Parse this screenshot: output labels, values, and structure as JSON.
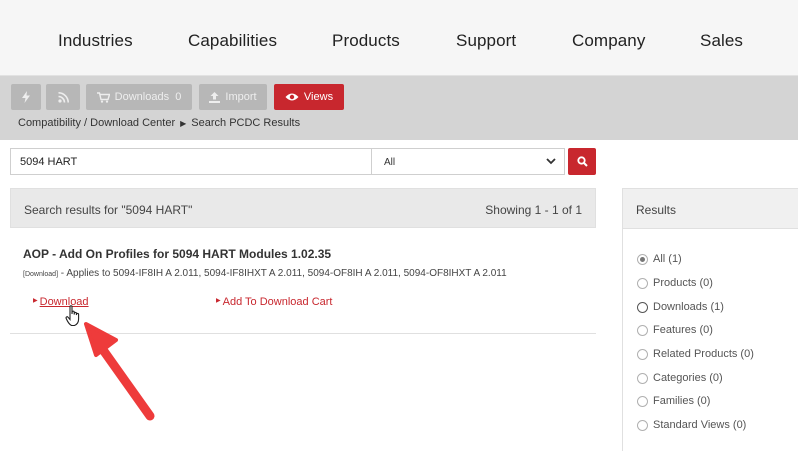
{
  "top_nav": {
    "items": [
      "Industries",
      "Capabilities",
      "Products",
      "Support",
      "Company",
      "Sales"
    ]
  },
  "toolbar": {
    "buttons": [
      {
        "icon": "lightning-icon",
        "label": ""
      },
      {
        "icon": "rss-icon",
        "label": ""
      },
      {
        "icon": "cart-icon",
        "label": "Downloads  0"
      },
      {
        "icon": "upload-icon",
        "label": "Import"
      },
      {
        "icon": "eye-icon",
        "label": "Views"
      }
    ],
    "accent_color": "#c8272e"
  },
  "breadcrumb": {
    "items": [
      "Compatibility / Download Center",
      "Search PCDC Results"
    ]
  },
  "search": {
    "query": "5094 HART",
    "scope": "All"
  },
  "results": {
    "summary": "Search results for \"5094 HART\"",
    "showing": "Showing 1 - 1 of 1",
    "items": [
      {
        "title": "AOP - Add On Profiles for 5094 HART Modules 1.02.35",
        "tag": "[Download]",
        "applies": " - Applies to 5094-IF8IH A 2.011, 5094-IF8IHXT A 2.011, 5094-OF8IH A 2.011, 5094-OF8IHXT A 2.011",
        "download_label": "Download",
        "cart_label": "Add To Download Cart"
      }
    ]
  },
  "results_panel": {
    "header": "Results",
    "filters": [
      {
        "label": "All (1)",
        "checked": true
      },
      {
        "label": "Products (0)",
        "checked": false
      },
      {
        "label": "Downloads (1)",
        "checked": false
      },
      {
        "label": "Features (0)",
        "checked": false
      },
      {
        "label": "Related Products (0)",
        "checked": false
      },
      {
        "label": "Categories (0)",
        "checked": false
      },
      {
        "label": "Families (0)",
        "checked": false
      },
      {
        "label": "Standard Views (0)",
        "checked": false
      }
    ]
  },
  "annotation": {
    "arrow_color": "#ee3b3b"
  }
}
